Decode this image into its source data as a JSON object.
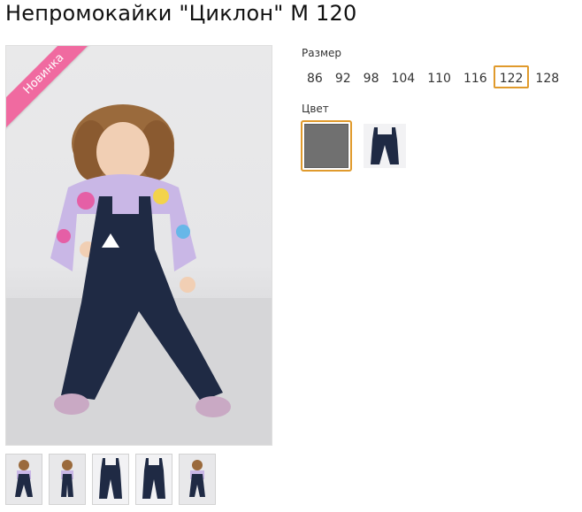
{
  "product": {
    "title": "Непромокайки \"Циклон\" М 120",
    "badge": "Новинка"
  },
  "size_selector": {
    "label": "Размер",
    "options": [
      "86",
      "92",
      "98",
      "104",
      "110",
      "116",
      "122",
      "128"
    ],
    "selected": "122"
  },
  "color_selector": {
    "label": "Цвет",
    "options": [
      {
        "name": "grey-swatch",
        "hex": "#707070",
        "selected": true
      },
      {
        "name": "navy-pants-swatch",
        "hex": "#1f2a44",
        "selected": false
      }
    ]
  },
  "colors": {
    "accent": "#e09a2c",
    "badge": "#f06aa0",
    "pants": "#1f2a44"
  },
  "thumbnails": [
    {
      "name": "thumb-girl-front"
    },
    {
      "name": "thumb-girl-side"
    },
    {
      "name": "thumb-pants-front"
    },
    {
      "name": "thumb-pants-back"
    },
    {
      "name": "thumb-girl-standing"
    }
  ]
}
